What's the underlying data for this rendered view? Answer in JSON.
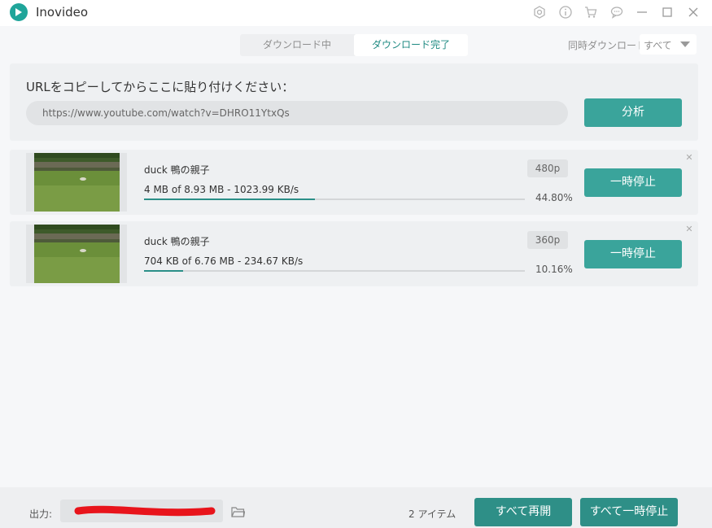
{
  "app": {
    "title": "Inovideo"
  },
  "titlebar_icons": [
    "settings-icon",
    "info-icon",
    "cart-icon",
    "chat-icon",
    "minimize-icon",
    "maximize-icon",
    "close-icon"
  ],
  "tabs": [
    {
      "label": "ダウンロード中",
      "active": false
    },
    {
      "label": "ダウンロード完了",
      "active": true
    }
  ],
  "concurrent": {
    "label": "同時ダウンロード",
    "value": "すべて"
  },
  "url_panel": {
    "label": "URLをコピーしてからここに貼り付けください：",
    "url": "https://www.youtube.com/watch?v=DHRO11YtxQs",
    "analyze_label": "分析"
  },
  "downloads": [
    {
      "title": "duck 鴨の親子",
      "progress_text": "4 MB of 8.93 MB - 1023.99 KB/s",
      "resolution": "480p",
      "percent": "44.80%",
      "progress": 0.448,
      "pause_label": "一時停止"
    },
    {
      "title": "duck 鴨の親子",
      "progress_text": "704 KB of 6.76 MB - 234.67 KB/s",
      "resolution": "360p",
      "percent": "10.16%",
      "progress": 0.1016,
      "pause_label": "一時停止"
    }
  ],
  "footer": {
    "output_label": "出力:",
    "item_count": "2 アイテム",
    "resume_all_label": "すべて再開",
    "pause_all_label": "すべて一時停止"
  },
  "colors": {
    "accent": "#3aa49b",
    "accent_dark": "#2e8f87",
    "progress": "#2b8f88",
    "redaction": "#e8141b"
  }
}
